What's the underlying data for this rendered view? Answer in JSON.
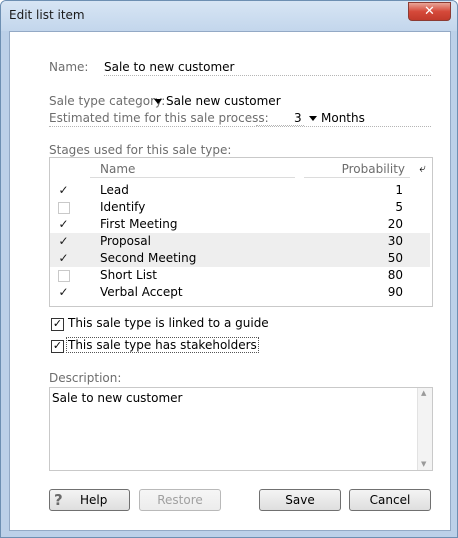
{
  "window": {
    "title": "Edit list item",
    "close_glyph": "✕"
  },
  "name": {
    "label": "Name:",
    "value": "Sale to new customer"
  },
  "sale_type_category": {
    "label": "Sale type category:",
    "value": "Sale new customer"
  },
  "estimated_time": {
    "label": "Estimated time for this sale process:",
    "amount": "3",
    "unit": "Months"
  },
  "stages": {
    "label": "Stages used for this sale type:",
    "columns": {
      "name": "Name",
      "probability": "Probability"
    },
    "rows": [
      {
        "checked": true,
        "name": "Lead",
        "probability": "1"
      },
      {
        "checked": false,
        "name": "Identify",
        "probability": "5"
      },
      {
        "checked": true,
        "name": "First Meeting",
        "probability": "20"
      },
      {
        "checked": true,
        "name": "Proposal",
        "probability": "30"
      },
      {
        "checked": true,
        "name": "Second Meeting",
        "probability": "50"
      },
      {
        "checked": false,
        "name": "Short List",
        "probability": "80"
      },
      {
        "checked": true,
        "name": "Verbal Accept",
        "probability": "90"
      }
    ]
  },
  "options": {
    "linked_to_guide": {
      "label": "This sale type is linked to a guide",
      "checked": true
    },
    "has_stakeholders": {
      "label": "This sale type has stakeholders",
      "checked": true
    }
  },
  "description": {
    "label": "Description:",
    "value": "Sale to new customer"
  },
  "buttons": {
    "help": "Help",
    "restore": "Restore",
    "save": "Save",
    "cancel": "Cancel"
  },
  "icons": {
    "check": "✓",
    "help": "question-mark-icon"
  }
}
